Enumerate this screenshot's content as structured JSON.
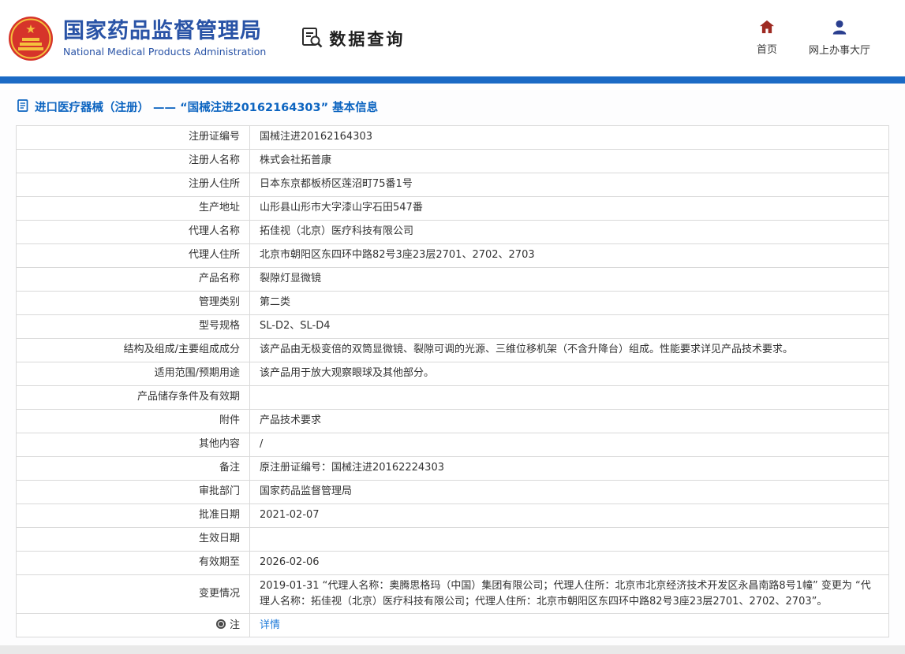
{
  "colors": {
    "brand_blue": "#2953a6",
    "bar_blue": "#1b6ac5",
    "breadcrumb_blue": "#0c64c0",
    "link_blue": "#1d7ad9",
    "home_icon_red": "#9e2a22",
    "person_icon_blue": "#2a3f8f",
    "emblem_red": "#d6342a",
    "emblem_gold": "#f5c13d"
  },
  "header": {
    "org_name_cn": "国家药品监督管理局",
    "org_name_en": "National Medical Products Administration",
    "query_title": "数据查询",
    "nav_home": "首页",
    "nav_hall": "网上办事大厅"
  },
  "breadcrumb": {
    "text": "进口医疗器械（注册） —— “国械注进20162164303” 基本信息"
  },
  "table": {
    "rows": [
      {
        "label": "注册证编号",
        "value": "国械注进20162164303"
      },
      {
        "label": "注册人名称",
        "value": "株式会社拓普康"
      },
      {
        "label": "注册人住所",
        "value": "日本东京都板桥区莲沼町75番1号"
      },
      {
        "label": "生产地址",
        "value": "山形县山形市大字漆山字石田547番"
      },
      {
        "label": "代理人名称",
        "value": "拓佳视（北京）医疗科技有限公司"
      },
      {
        "label": "代理人住所",
        "value": "北京市朝阳区东四环中路82号3座23层2701、2702、2703"
      },
      {
        "label": "产品名称",
        "value": "裂隙灯显微镜"
      },
      {
        "label": "管理类别",
        "value": "第二类"
      },
      {
        "label": "型号规格",
        "value": "SL-D2、SL-D4"
      },
      {
        "label": "结构及组成/主要组成成分",
        "value": "该产品由无极变倍的双筒显微镜、裂隙可调的光源、三维位移机架（不含升降台）组成。性能要求详见产品技术要求。"
      },
      {
        "label": "适用范围/预期用途",
        "value": "该产品用于放大观察眼球及其他部分。"
      },
      {
        "label": "产品储存条件及有效期",
        "value": ""
      },
      {
        "label": "附件",
        "value": "产品技术要求"
      },
      {
        "label": "其他内容",
        "value": "/"
      },
      {
        "label": "备注",
        "value": "原注册证编号：国械注进20162224303"
      },
      {
        "label": "审批部门",
        "value": "国家药品监督管理局"
      },
      {
        "label": "批准日期",
        "value": "2021-02-07"
      },
      {
        "label": "生效日期",
        "value": ""
      },
      {
        "label": "有效期至",
        "value": "2026-02-06"
      },
      {
        "label": "变更情况",
        "value": "2019-01-31 “代理人名称：奥腾思格玛（中国）集团有限公司；代理人住所：北京市北京经济技术开发区永昌南路8号1幢” 变更为 “代理人名称：拓佳视（北京）医疗科技有限公司；代理人住所：北京市朝阳区东四环中路82号3座23层2701、2702、2703”。"
      },
      {
        "label": "注",
        "label_icon": "note-icon",
        "value": "详情",
        "value_link": true
      }
    ]
  }
}
